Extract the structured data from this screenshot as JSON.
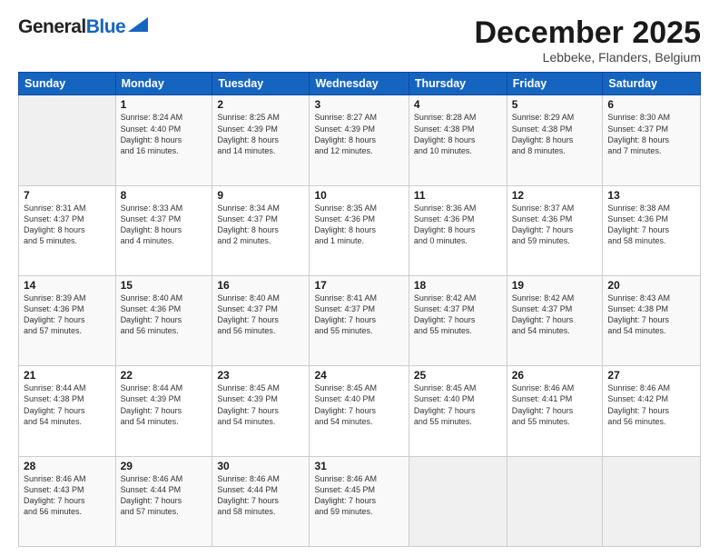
{
  "header": {
    "logo_general": "General",
    "logo_blue": "Blue",
    "month_title": "December 2025",
    "location": "Lebbeke, Flanders, Belgium"
  },
  "weekdays": [
    "Sunday",
    "Monday",
    "Tuesday",
    "Wednesday",
    "Thursday",
    "Friday",
    "Saturday"
  ],
  "weeks": [
    [
      {
        "day": "",
        "info": ""
      },
      {
        "day": "1",
        "info": "Sunrise: 8:24 AM\nSunset: 4:40 PM\nDaylight: 8 hours\nand 16 minutes."
      },
      {
        "day": "2",
        "info": "Sunrise: 8:25 AM\nSunset: 4:39 PM\nDaylight: 8 hours\nand 14 minutes."
      },
      {
        "day": "3",
        "info": "Sunrise: 8:27 AM\nSunset: 4:39 PM\nDaylight: 8 hours\nand 12 minutes."
      },
      {
        "day": "4",
        "info": "Sunrise: 8:28 AM\nSunset: 4:38 PM\nDaylight: 8 hours\nand 10 minutes."
      },
      {
        "day": "5",
        "info": "Sunrise: 8:29 AM\nSunset: 4:38 PM\nDaylight: 8 hours\nand 8 minutes."
      },
      {
        "day": "6",
        "info": "Sunrise: 8:30 AM\nSunset: 4:37 PM\nDaylight: 8 hours\nand 7 minutes."
      }
    ],
    [
      {
        "day": "7",
        "info": "Sunrise: 8:31 AM\nSunset: 4:37 PM\nDaylight: 8 hours\nand 5 minutes."
      },
      {
        "day": "8",
        "info": "Sunrise: 8:33 AM\nSunset: 4:37 PM\nDaylight: 8 hours\nand 4 minutes."
      },
      {
        "day": "9",
        "info": "Sunrise: 8:34 AM\nSunset: 4:37 PM\nDaylight: 8 hours\nand 2 minutes."
      },
      {
        "day": "10",
        "info": "Sunrise: 8:35 AM\nSunset: 4:36 PM\nDaylight: 8 hours\nand 1 minute."
      },
      {
        "day": "11",
        "info": "Sunrise: 8:36 AM\nSunset: 4:36 PM\nDaylight: 8 hours\nand 0 minutes."
      },
      {
        "day": "12",
        "info": "Sunrise: 8:37 AM\nSunset: 4:36 PM\nDaylight: 7 hours\nand 59 minutes."
      },
      {
        "day": "13",
        "info": "Sunrise: 8:38 AM\nSunset: 4:36 PM\nDaylight: 7 hours\nand 58 minutes."
      }
    ],
    [
      {
        "day": "14",
        "info": "Sunrise: 8:39 AM\nSunset: 4:36 PM\nDaylight: 7 hours\nand 57 minutes."
      },
      {
        "day": "15",
        "info": "Sunrise: 8:40 AM\nSunset: 4:36 PM\nDaylight: 7 hours\nand 56 minutes."
      },
      {
        "day": "16",
        "info": "Sunrise: 8:40 AM\nSunset: 4:37 PM\nDaylight: 7 hours\nand 56 minutes."
      },
      {
        "day": "17",
        "info": "Sunrise: 8:41 AM\nSunset: 4:37 PM\nDaylight: 7 hours\nand 55 minutes."
      },
      {
        "day": "18",
        "info": "Sunrise: 8:42 AM\nSunset: 4:37 PM\nDaylight: 7 hours\nand 55 minutes."
      },
      {
        "day": "19",
        "info": "Sunrise: 8:42 AM\nSunset: 4:37 PM\nDaylight: 7 hours\nand 54 minutes."
      },
      {
        "day": "20",
        "info": "Sunrise: 8:43 AM\nSunset: 4:38 PM\nDaylight: 7 hours\nand 54 minutes."
      }
    ],
    [
      {
        "day": "21",
        "info": "Sunrise: 8:44 AM\nSunset: 4:38 PM\nDaylight: 7 hours\nand 54 minutes."
      },
      {
        "day": "22",
        "info": "Sunrise: 8:44 AM\nSunset: 4:39 PM\nDaylight: 7 hours\nand 54 minutes."
      },
      {
        "day": "23",
        "info": "Sunrise: 8:45 AM\nSunset: 4:39 PM\nDaylight: 7 hours\nand 54 minutes."
      },
      {
        "day": "24",
        "info": "Sunrise: 8:45 AM\nSunset: 4:40 PM\nDaylight: 7 hours\nand 54 minutes."
      },
      {
        "day": "25",
        "info": "Sunrise: 8:45 AM\nSunset: 4:40 PM\nDaylight: 7 hours\nand 55 minutes."
      },
      {
        "day": "26",
        "info": "Sunrise: 8:46 AM\nSunset: 4:41 PM\nDaylight: 7 hours\nand 55 minutes."
      },
      {
        "day": "27",
        "info": "Sunrise: 8:46 AM\nSunset: 4:42 PM\nDaylight: 7 hours\nand 56 minutes."
      }
    ],
    [
      {
        "day": "28",
        "info": "Sunrise: 8:46 AM\nSunset: 4:43 PM\nDaylight: 7 hours\nand 56 minutes."
      },
      {
        "day": "29",
        "info": "Sunrise: 8:46 AM\nSunset: 4:44 PM\nDaylight: 7 hours\nand 57 minutes."
      },
      {
        "day": "30",
        "info": "Sunrise: 8:46 AM\nSunset: 4:44 PM\nDaylight: 7 hours\nand 58 minutes."
      },
      {
        "day": "31",
        "info": "Sunrise: 8:46 AM\nSunset: 4:45 PM\nDaylight: 7 hours\nand 59 minutes."
      },
      {
        "day": "",
        "info": ""
      },
      {
        "day": "",
        "info": ""
      },
      {
        "day": "",
        "info": ""
      }
    ]
  ]
}
